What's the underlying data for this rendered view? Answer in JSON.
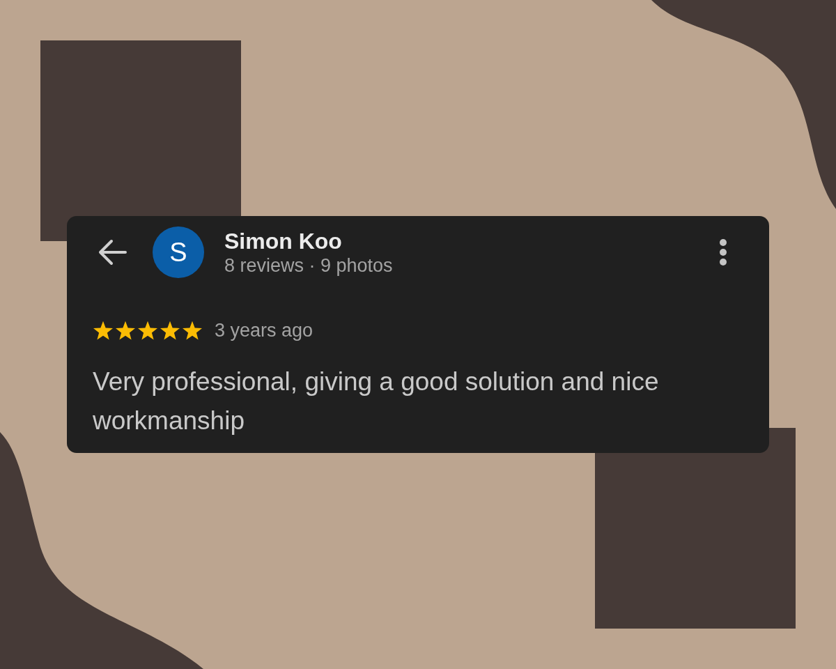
{
  "reviewer": {
    "avatar_letter": "S",
    "name": "Simon Koo",
    "stats": "8 reviews · 9 photos"
  },
  "review": {
    "stars": 5,
    "time": "3 years ago",
    "text": "Very professional, giving a good solution and nice workmanship"
  }
}
